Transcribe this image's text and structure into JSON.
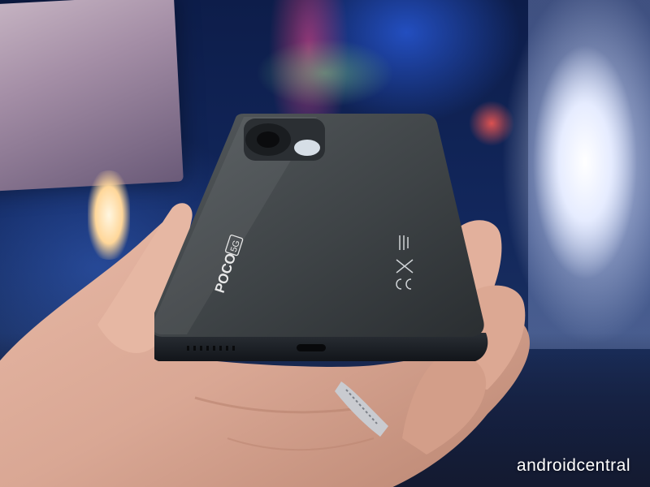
{
  "image": {
    "subject": "black smartphone held in hand",
    "palette": {
      "background_blue": "#12275c",
      "skin": "#d9a794",
      "phone_body": "#3c4144",
      "accent_red": "#ff5a50",
      "accent_green": "#78c882"
    }
  },
  "phone": {
    "brand_label": "POCO",
    "badge_label": "5G"
  },
  "watermark": {
    "text": "androidcentral"
  }
}
